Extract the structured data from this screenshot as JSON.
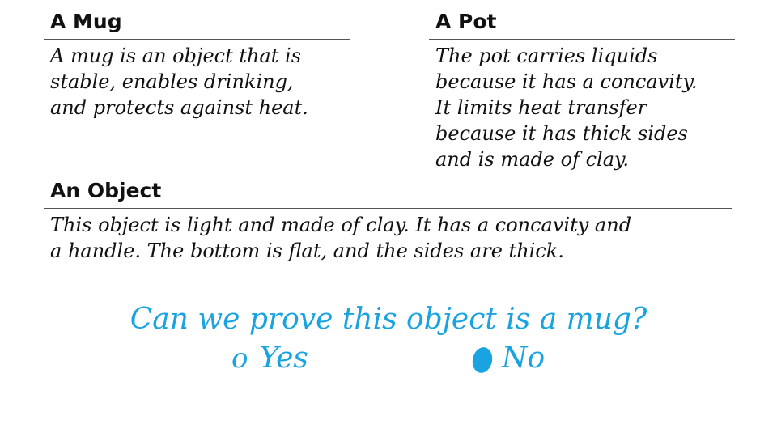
{
  "sections": {
    "mug": {
      "heading": "A Mug",
      "text": "A mug is an object that is\nstable, enables drinking,\nand protects against heat."
    },
    "pot": {
      "heading": "A Pot",
      "text": "The pot carries liquids\nbecause it has a concavity.\nIt limits heat transfer\nbecause it has thick sides\nand is made of clay."
    },
    "object": {
      "heading": "An Object",
      "text": "This object is light and made of clay. It has a concavity and\na handle. The bottom is flat, and the sides are thick."
    }
  },
  "question": {
    "text": "Can we prove this object is a mug?",
    "options": [
      {
        "label": "Yes",
        "marker": "o",
        "selected": false
      },
      {
        "label": "No",
        "marker": "●",
        "selected": true
      }
    ]
  },
  "colors": {
    "accent": "#19a3e0",
    "text": "#111111",
    "rule": "#555555"
  }
}
